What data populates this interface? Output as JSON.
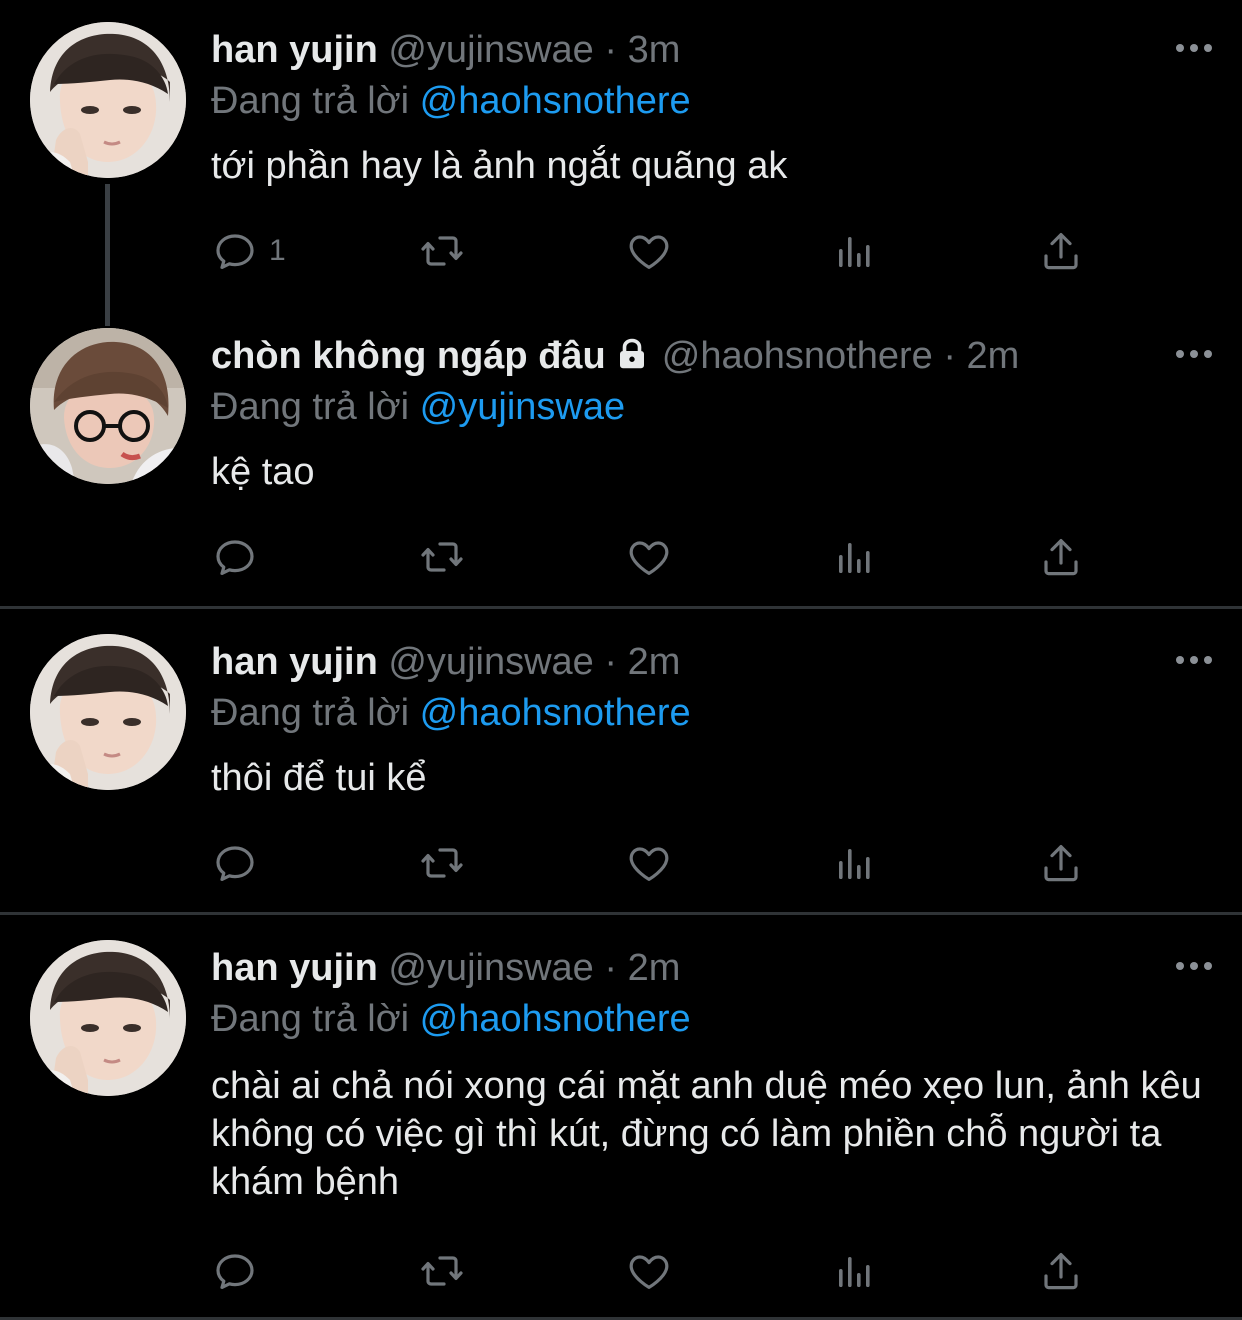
{
  "tweets": [
    {
      "name": "han yujin",
      "handle": "@yujinswae",
      "time": "· 3m",
      "reply_prefix": "Đang trả lời",
      "reply_to": "@haohsnothere",
      "text": "tới phần hay là ảnh ngắt quãng ak",
      "reply_count": "1",
      "avatar": "avatar-yujin"
    },
    {
      "name": "chòn không ngáp đâu",
      "handle": "@haohsnothere",
      "time": "· 2m",
      "reply_prefix": "Đang trả lời",
      "reply_to": "@yujinswae",
      "text": "kệ tao",
      "reply_count": "",
      "locked": true,
      "avatar": "avatar-haoh"
    },
    {
      "name": "han yujin",
      "handle": "@yujinswae",
      "time": "· 2m",
      "reply_prefix": "Đang trả lời",
      "reply_to": "@haohsnothere",
      "text": "thôi để tui kể",
      "reply_count": "",
      "avatar": "avatar-yujin"
    },
    {
      "name": "han yujin",
      "handle": "@yujinswae",
      "time": "· 2m",
      "reply_prefix": "Đang trả lời",
      "reply_to": "@haohsnothere",
      "text": "chài ai chả nói xong cái mặt anh duệ méo xẹo lun, ảnh kêu không có việc gì thì kút, đừng có làm phiền chỗ người ta khám bệnh",
      "reply_count": "",
      "avatar": "avatar-yujin"
    }
  ],
  "icons": {
    "reply": "reply-icon",
    "retweet": "retweet-icon",
    "like": "heart-icon",
    "views": "views-icon",
    "share": "share-icon",
    "more": "more-icon",
    "lock": "lock-icon"
  },
  "colors": {
    "background": "#000000",
    "text": "#e7e9ea",
    "secondary": "#71767b",
    "mention": "#1d9bf0",
    "divider": "#2f3336"
  }
}
